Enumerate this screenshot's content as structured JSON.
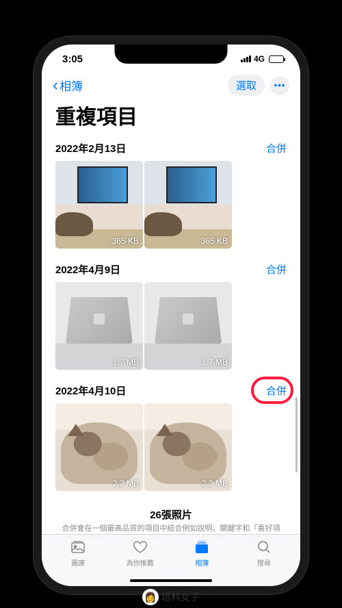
{
  "status": {
    "time": "3:05",
    "network": "4G"
  },
  "nav": {
    "back": "相簿",
    "select": "選取"
  },
  "title": "重複項目",
  "groups": [
    {
      "date": "2022年2月13日",
      "merge": "合併",
      "thumbs": [
        {
          "size": "365 KB",
          "kind": "desk"
        },
        {
          "size": "365 KB",
          "kind": "desk"
        }
      ]
    },
    {
      "date": "2022年4月9日",
      "merge": "合併",
      "thumbs": [
        {
          "size": "1.7 MB",
          "kind": "laptop"
        },
        {
          "size": "1.7 MB",
          "kind": "laptop"
        }
      ]
    },
    {
      "date": "2022年4月10日",
      "merge": "合併",
      "highlighted": true,
      "thumbs": [
        {
          "size": "2.2 MB",
          "kind": "cat"
        },
        {
          "size": "2.2 MB",
          "kind": "cat"
        }
      ]
    }
  ],
  "summary": {
    "title": "26張照片",
    "text": "合併會在一個最高品質的項目中結合例如說明、關鍵字和「喜好項目」等相關資料。包含重複項目的相簿會以合併後的項目更新。"
  },
  "tabs": [
    {
      "label": "圖庫",
      "icon": "library-icon"
    },
    {
      "label": "為你推薦",
      "icon": "foryou-icon"
    },
    {
      "label": "相簿",
      "icon": "albums-icon",
      "active": true
    },
    {
      "label": "搜尋",
      "icon": "search-icon"
    }
  ],
  "watermark": "塔科女子"
}
